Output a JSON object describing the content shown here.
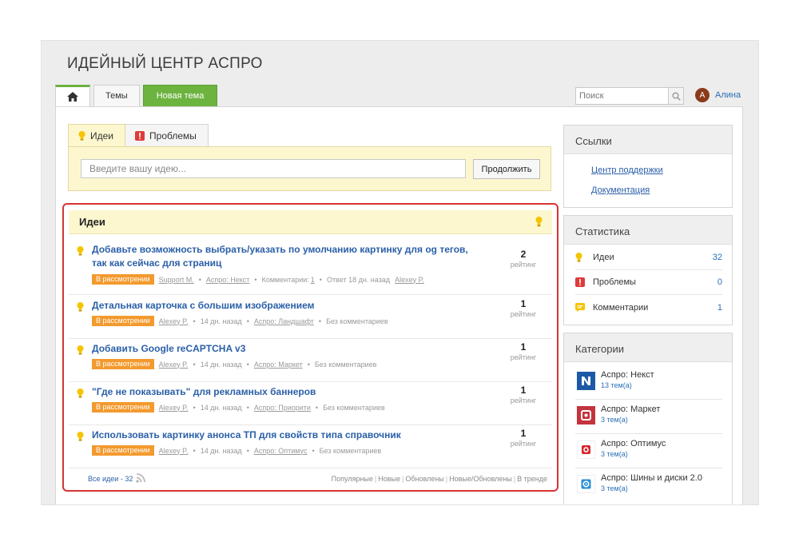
{
  "header": {
    "title": "ИДЕЙНЫЙ ЦЕНТР АСПРО"
  },
  "nav": {
    "home_icon": "home-icon",
    "tab_topics": "Темы",
    "tab_new": "Новая тема",
    "accent_color": "#6cb33f"
  },
  "search": {
    "placeholder": "Поиск",
    "icon": "search-icon"
  },
  "user": {
    "initial": "А",
    "name": "Алина"
  },
  "idea_form": {
    "tab_ideas": "Идеи",
    "tab_problems": "Проблемы",
    "input_placeholder": "Введите вашу идею...",
    "submit_label": "Продолжить"
  },
  "ideas": {
    "title": "Идеи",
    "items": [
      {
        "title": "Добавьте возможность выбрать/указать по умолчанию картинку для og тегов, так как сейчас для страниц",
        "status": "В рассмотрении",
        "author": "Support M.",
        "category": "Аспро: Некст",
        "comments_label": "Комментарии:",
        "comments_count": "1",
        "answer": "Ответ  18 дн. назад",
        "answer_author": "Alexey P.",
        "rating": "2",
        "rating_label": "рейтинг"
      },
      {
        "title": "Детальная карточка с большим изображением",
        "status": "В рассмотрении",
        "author": "Alexey P.",
        "time": "14 дн. назад",
        "category": "Аспро: Ландшафт",
        "comments": "Без комментариев",
        "rating": "1",
        "rating_label": "рейтинг"
      },
      {
        "title": "Добавить Google reCAPTCHA v3",
        "status": "В рассмотрении",
        "author": "Alexey P.",
        "time": "14 дн. назад",
        "category": "Аспро: Маркет",
        "comments": "Без комментариев",
        "rating": "1",
        "rating_label": "рейтинг"
      },
      {
        "title": "\"Где не показывать\" для рекламных баннеров",
        "status": "В рассмотрении",
        "author": "Alexey P.",
        "time": "14 дн. назад",
        "category": "Аспро: Приорити",
        "comments": "Без комментариев",
        "rating": "1",
        "rating_label": "рейтинг"
      },
      {
        "title": "Использовать картинку анонса ТП для свойств типа справочник",
        "status": "В рассмотрении",
        "author": "Alexey P.",
        "time": "14 дн. назад",
        "category": "Аспро: Оптимус",
        "comments": "Без комментариев",
        "rating": "1",
        "rating_label": "рейтинг"
      }
    ],
    "all_link": "Все идеи - 32",
    "sort_links": [
      "Популярные",
      "Новые",
      "Обновлены",
      "Новые/Обновлены",
      "В тренде"
    ],
    "highlight_color": "#d83434",
    "status_color": "#f39a2e"
  },
  "sidebar": {
    "links": {
      "title": "Ссылки",
      "items": [
        "Центр поддержки",
        "Документация"
      ]
    },
    "stats": {
      "title": "Статистика",
      "items": [
        {
          "label": "Идеи",
          "count": "32",
          "icon": "lightbulb-icon"
        },
        {
          "label": "Проблемы",
          "count": "0",
          "icon": "alert-icon"
        },
        {
          "label": "Комментарии",
          "count": "1",
          "icon": "comment-icon"
        }
      ]
    },
    "categories": {
      "title": "Категории",
      "items": [
        {
          "name": "Аспро: Некст",
          "count": "13 тем(а)",
          "color": "#1b5aa7"
        },
        {
          "name": "Аспро: Маркет",
          "count": "3 тем(а)",
          "color": "#c3343d"
        },
        {
          "name": "Аспро: Оптимус",
          "count": "3 тем(а)",
          "color": "#d8282f"
        },
        {
          "name": "Аспро: Шины и диски 2.0",
          "count": "3 тем(а)",
          "color": "#2a8fd6"
        }
      ]
    }
  }
}
